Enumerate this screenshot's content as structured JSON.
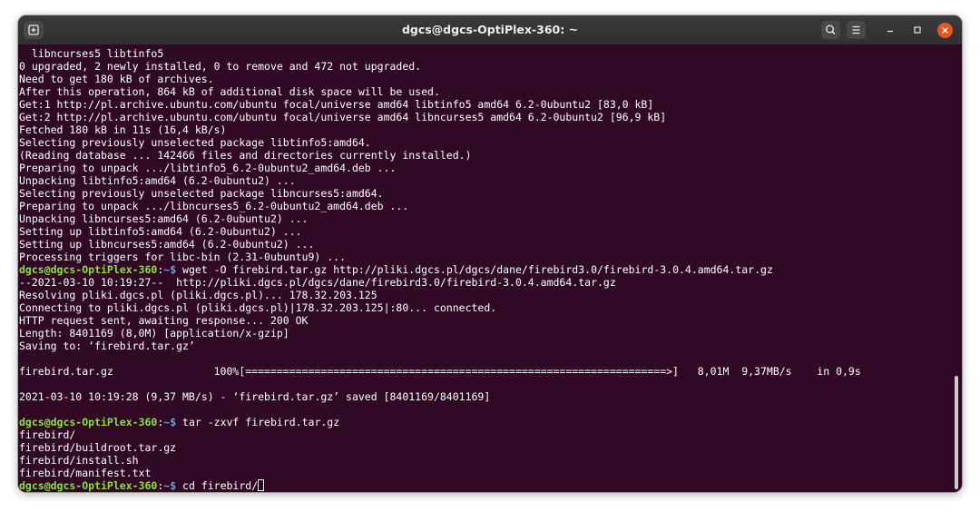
{
  "window": {
    "title": "dgcs@dgcs-OptiPlex-360: ~"
  },
  "prompt": {
    "user_host": "dgcs@dgcs-OptiPlex-360",
    "separator": ":",
    "path_symbol": "~$"
  },
  "terminal_lines": [
    {
      "type": "output",
      "text": "  libncurses5 libtinfo5"
    },
    {
      "type": "output",
      "text": "0 upgraded, 2 newly installed, 0 to remove and 472 not upgraded."
    },
    {
      "type": "output",
      "text": "Need to get 180 kB of archives."
    },
    {
      "type": "output",
      "text": "After this operation, 864 kB of additional disk space will be used."
    },
    {
      "type": "output",
      "text": "Get:1 http://pl.archive.ubuntu.com/ubuntu focal/universe amd64 libtinfo5 amd64 6.2-0ubuntu2 [83,0 kB]"
    },
    {
      "type": "output",
      "text": "Get:2 http://pl.archive.ubuntu.com/ubuntu focal/universe amd64 libncurses5 amd64 6.2-0ubuntu2 [96,9 kB]"
    },
    {
      "type": "output",
      "text": "Fetched 180 kB in 11s (16,4 kB/s)"
    },
    {
      "type": "output",
      "text": "Selecting previously unselected package libtinfo5:amd64."
    },
    {
      "type": "output",
      "text": "(Reading database ... 142466 files and directories currently installed.)"
    },
    {
      "type": "output",
      "text": "Preparing to unpack .../libtinfo5_6.2-0ubuntu2_amd64.deb ..."
    },
    {
      "type": "output",
      "text": "Unpacking libtinfo5:amd64 (6.2-0ubuntu2) ..."
    },
    {
      "type": "output",
      "text": "Selecting previously unselected package libncurses5:amd64."
    },
    {
      "type": "output",
      "text": "Preparing to unpack .../libncurses5_6.2-0ubuntu2_amd64.deb ..."
    },
    {
      "type": "output",
      "text": "Unpacking libncurses5:amd64 (6.2-0ubuntu2) ..."
    },
    {
      "type": "output",
      "text": "Setting up libtinfo5:amd64 (6.2-0ubuntu2) ..."
    },
    {
      "type": "output",
      "text": "Setting up libncurses5:amd64 (6.2-0ubuntu2) ..."
    },
    {
      "type": "output",
      "text": "Processing triggers for libc-bin (2.31-0ubuntu9) ..."
    },
    {
      "type": "command",
      "text": " wget -O firebird.tar.gz http://pliki.dgcs.pl/dgcs/dane/firebird3.0/firebird-3.0.4.amd64.tar.gz"
    },
    {
      "type": "output",
      "text": "--2021-03-10 10:19:27--  http://pliki.dgcs.pl/dgcs/dane/firebird3.0/firebird-3.0.4.amd64.tar.gz"
    },
    {
      "type": "output",
      "text": "Resolving pliki.dgcs.pl (pliki.dgcs.pl)... 178.32.203.125"
    },
    {
      "type": "output",
      "text": "Connecting to pliki.dgcs.pl (pliki.dgcs.pl)|178.32.203.125|:80... connected."
    },
    {
      "type": "output",
      "text": "HTTP request sent, awaiting response... 200 OK"
    },
    {
      "type": "output",
      "text": "Length: 8401169 (8,0M) [application/x-gzip]"
    },
    {
      "type": "output",
      "text": "Saving to: ‘firebird.tar.gz’"
    },
    {
      "type": "output",
      "text": ""
    },
    {
      "type": "output",
      "text": "firebird.tar.gz                100%[===================================================================>]   8,01M  9,37MB/s    in 0,9s"
    },
    {
      "type": "output",
      "text": ""
    },
    {
      "type": "output",
      "text": "2021-03-10 10:19:28 (9,37 MB/s) - ‘firebird.tar.gz’ saved [8401169/8401169]"
    },
    {
      "type": "output",
      "text": ""
    },
    {
      "type": "command",
      "text": " tar -zxvf firebird.tar.gz"
    },
    {
      "type": "output",
      "text": "firebird/"
    },
    {
      "type": "output",
      "text": "firebird/buildroot.tar.gz"
    },
    {
      "type": "output",
      "text": "firebird/install.sh"
    },
    {
      "type": "output",
      "text": "firebird/manifest.txt"
    },
    {
      "type": "active",
      "text": " cd firebird/"
    }
  ],
  "download": {
    "progress_percent": 100
  }
}
